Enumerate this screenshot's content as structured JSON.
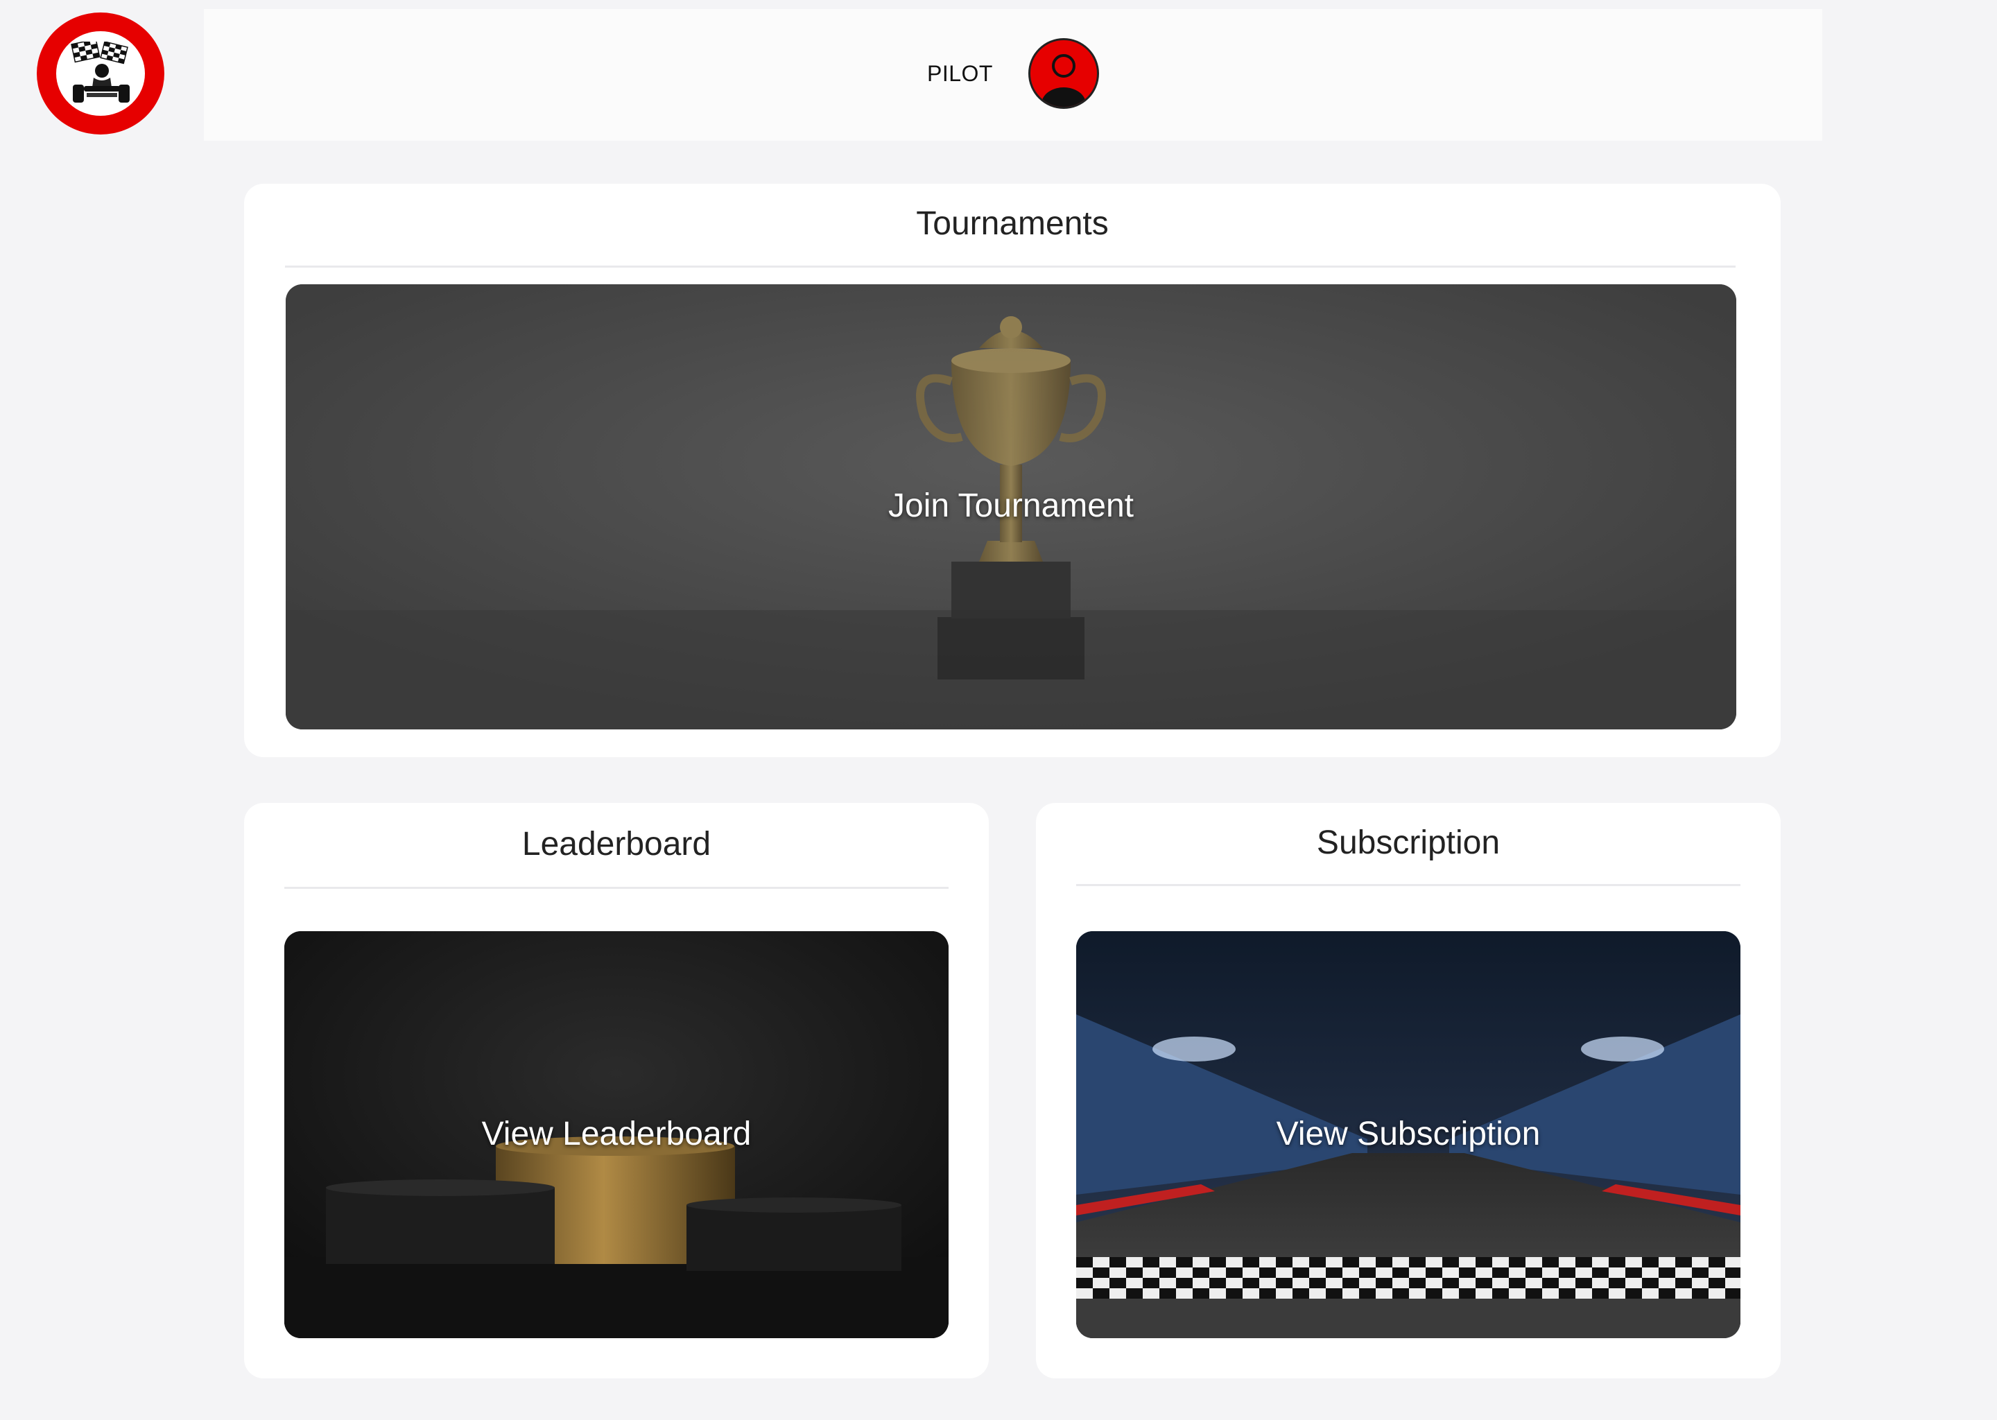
{
  "header": {
    "logo_icon": "go-kart-checkered-flag-icon",
    "role_label": "PILOT",
    "avatar_icon": "user-avatar-icon"
  },
  "tournaments": {
    "title": "Tournaments",
    "action_label": "Join Tournament",
    "image_icon": "trophy-icon"
  },
  "leaderboard": {
    "title": "Leaderboard",
    "action_label": "View Leaderboard",
    "image_icon": "podium-icon"
  },
  "subscription": {
    "title": "Subscription",
    "action_label": "View Subscription",
    "image_icon": "race-track-icon"
  },
  "colors": {
    "brand_red": "#e60000",
    "page_bg": "#f4f4f6",
    "card_bg": "#ffffff"
  }
}
